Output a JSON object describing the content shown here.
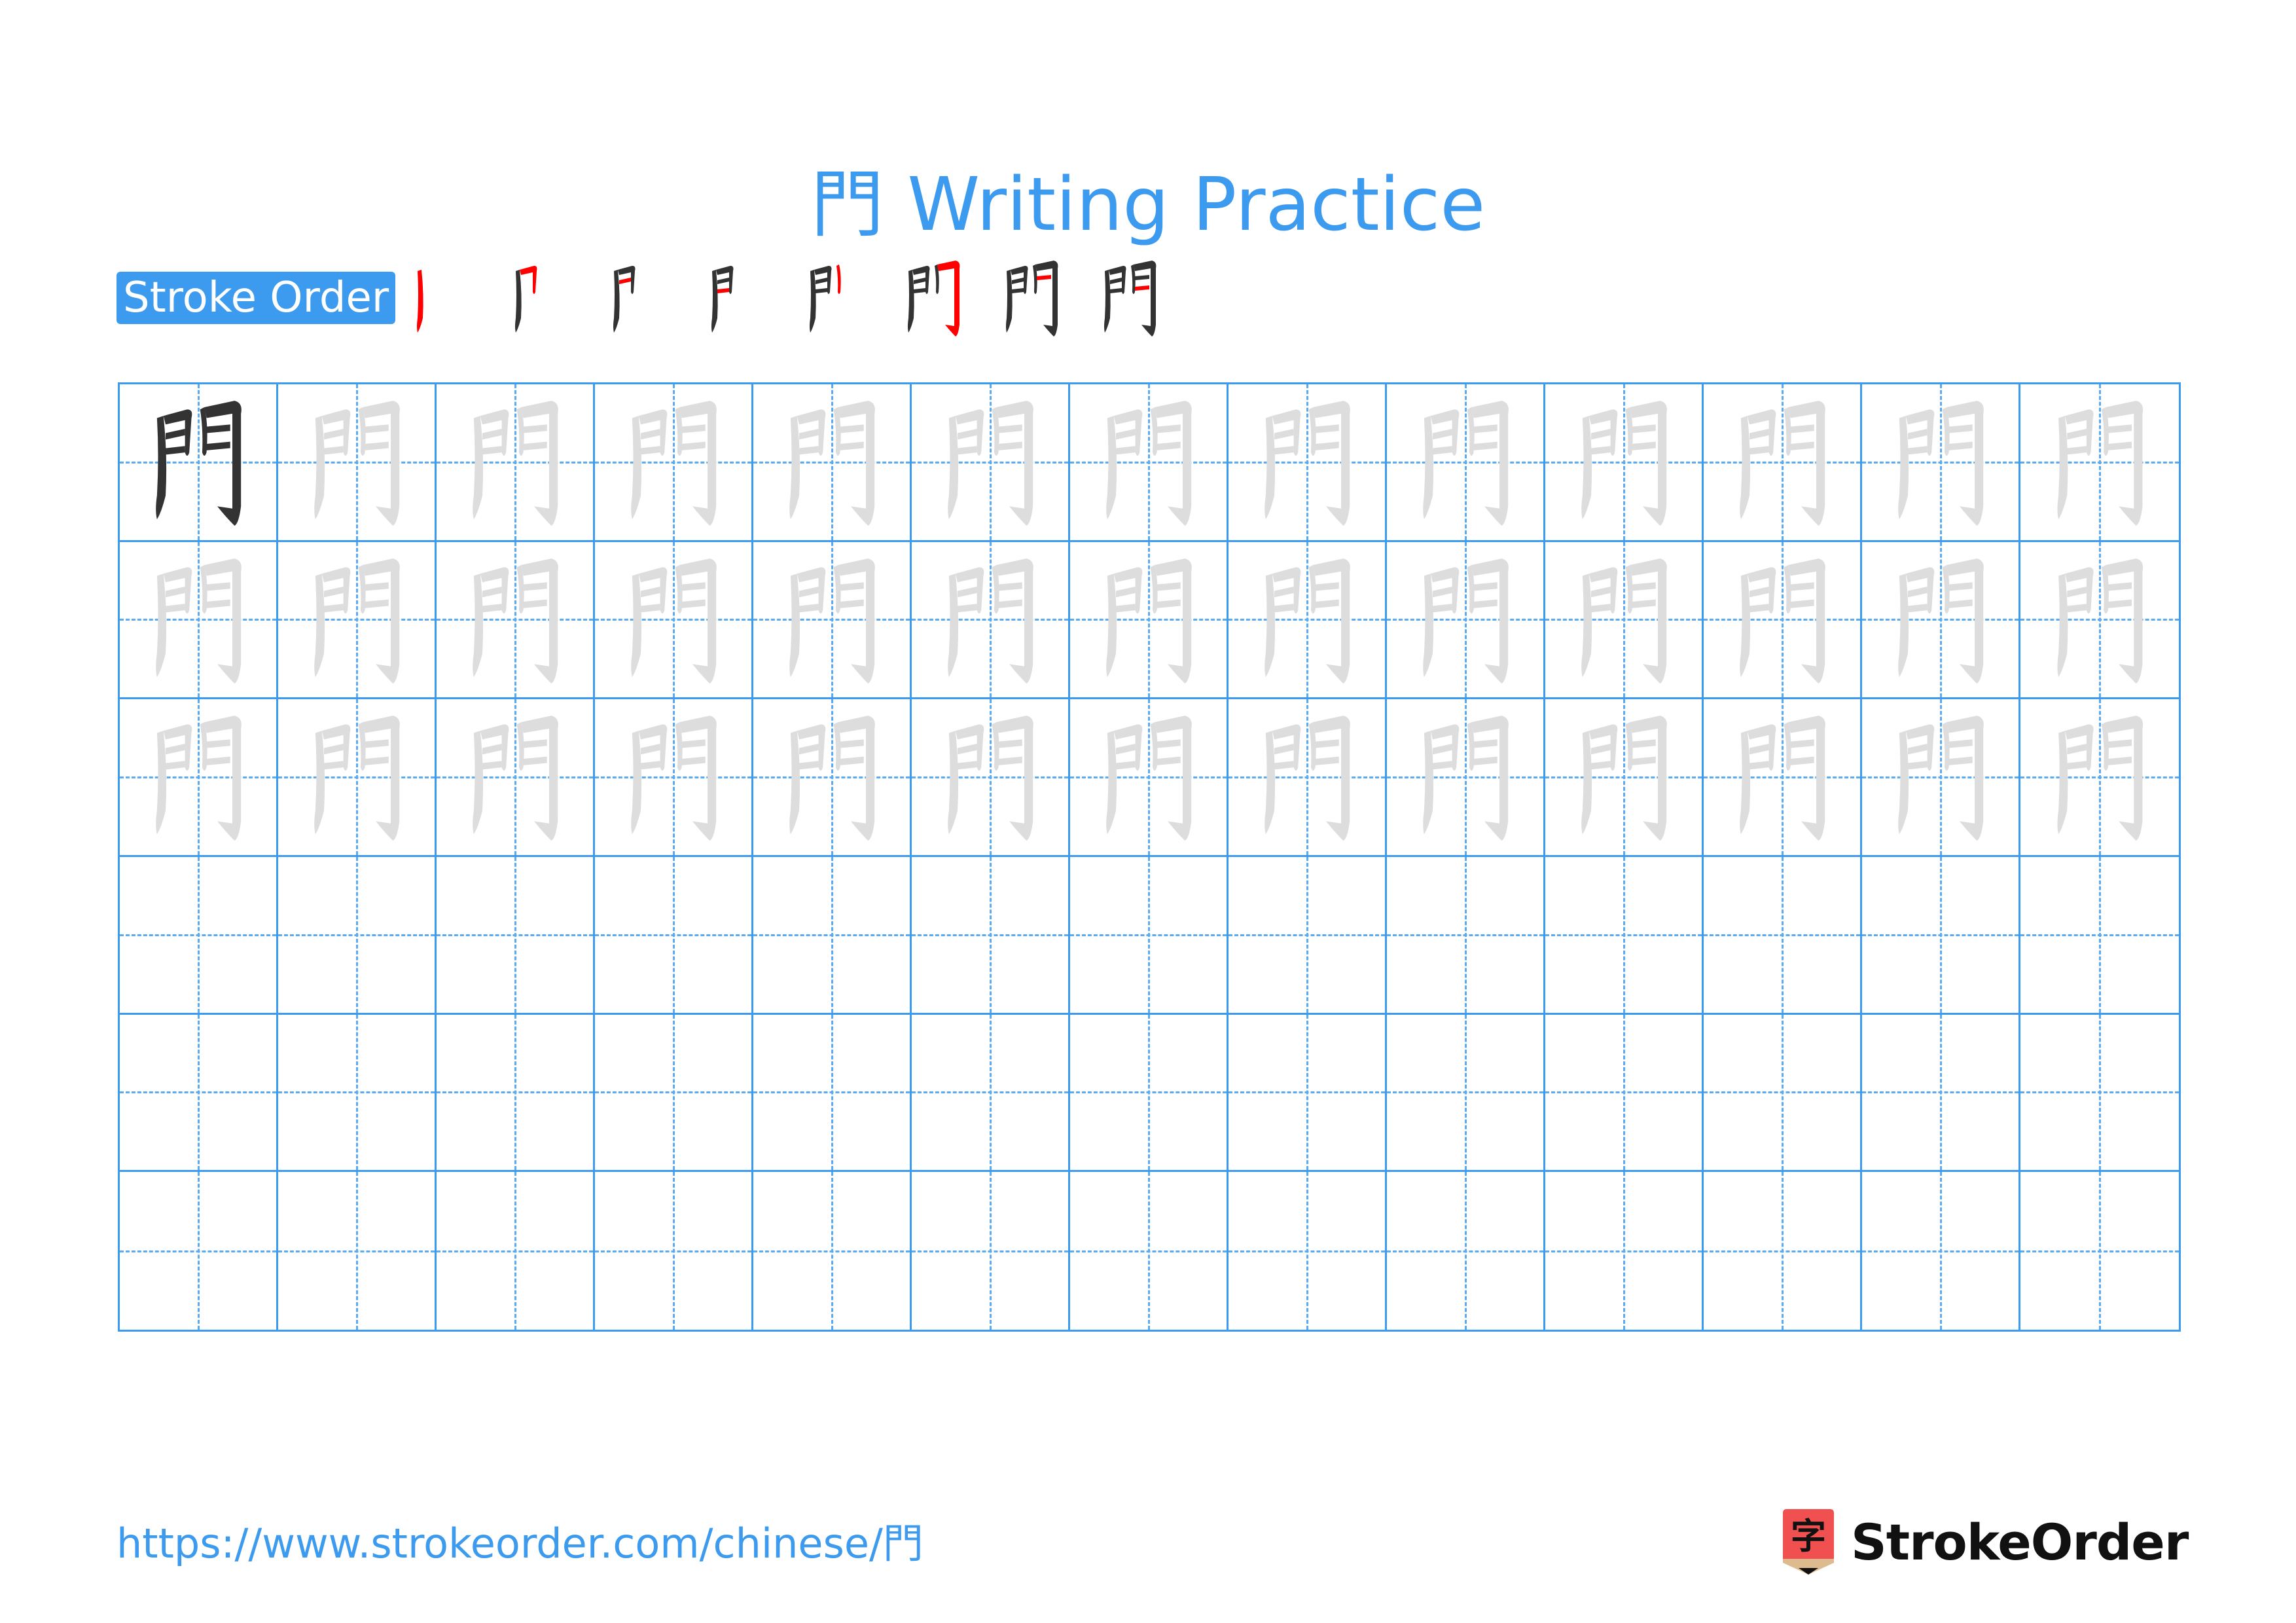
{
  "document": {
    "title": "門 Writing Practice",
    "character": "門",
    "stroke_count": 8
  },
  "stroke_order": {
    "badge_label": "Stroke Order",
    "steps": [
      1,
      2,
      3,
      4,
      5,
      6,
      7,
      8
    ]
  },
  "grid": {
    "columns": 13,
    "rows": 6,
    "row_types": [
      "model-then-trace",
      "trace",
      "trace",
      "blank",
      "blank",
      "blank"
    ]
  },
  "colors": {
    "accent": "#3d9bef",
    "guide": "#5aabf2",
    "model_stroke": "#333333",
    "trace_stroke": "#dddddd",
    "current_stroke": "#ff0000",
    "logo_red": "#f0504f",
    "logo_tan": "#ddbb8f"
  },
  "footer": {
    "url": "https://www.strokeorder.com/chinese/門",
    "logo_glyph": "字",
    "logo_text": "StrokeOrder"
  }
}
